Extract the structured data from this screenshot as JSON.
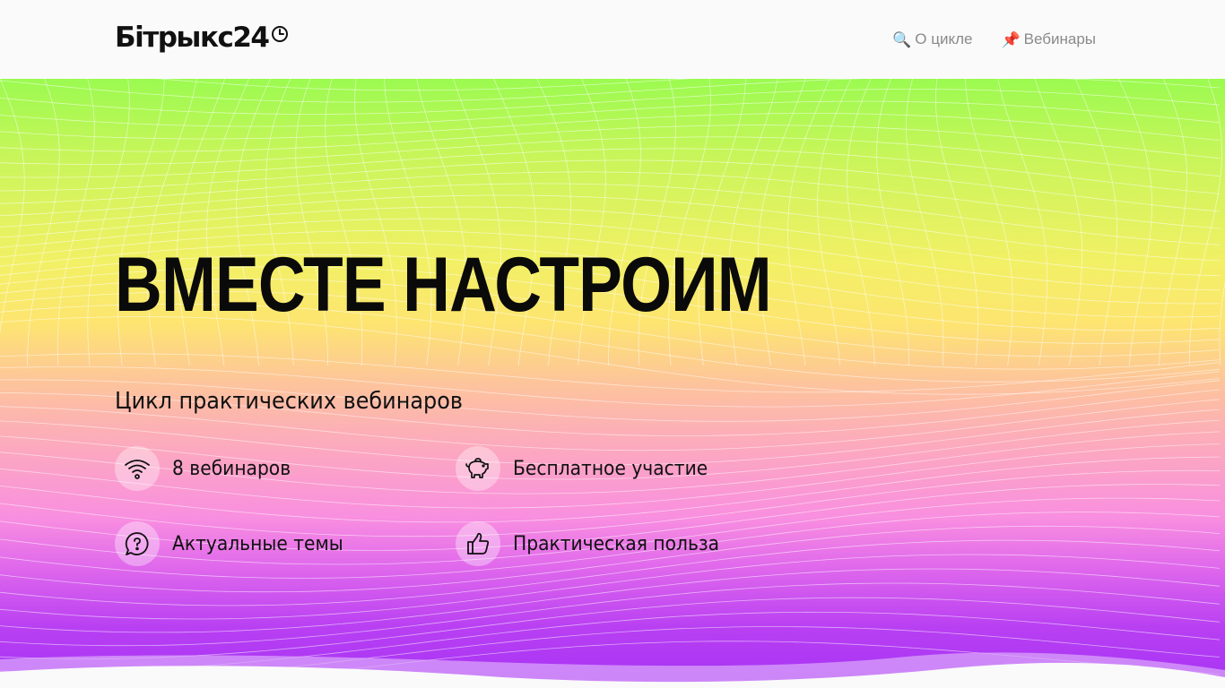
{
  "header": {
    "logo_text": "Бітрыкс24",
    "nav": [
      {
        "icon": "magnifier-icon",
        "glyph": "🔍",
        "label": "О цикле"
      },
      {
        "icon": "pushpin-icon",
        "glyph": "📌",
        "label": "Вебинары"
      }
    ]
  },
  "hero": {
    "title": "ВМЕСТЕ НАСТРОИМ",
    "subtitle": "Цикл практических вебинаров",
    "features": [
      {
        "icon": "wifi-icon",
        "label": "8 вебинаров"
      },
      {
        "icon": "piggy-bank-icon",
        "label": "Бесплатное участие"
      },
      {
        "icon": "question-bubble-icon",
        "label": "Актуальные темы"
      },
      {
        "icon": "thumbs-up-icon",
        "label": "Практическая польза"
      }
    ]
  },
  "colors": {
    "gradient_top": "#9bfa50",
    "gradient_middle": "#fde570",
    "gradient_pink": "#f98fe0",
    "gradient_bottom": "#a532f5",
    "text": "#0a0a0a",
    "nav_text": "#8a8a8a"
  }
}
